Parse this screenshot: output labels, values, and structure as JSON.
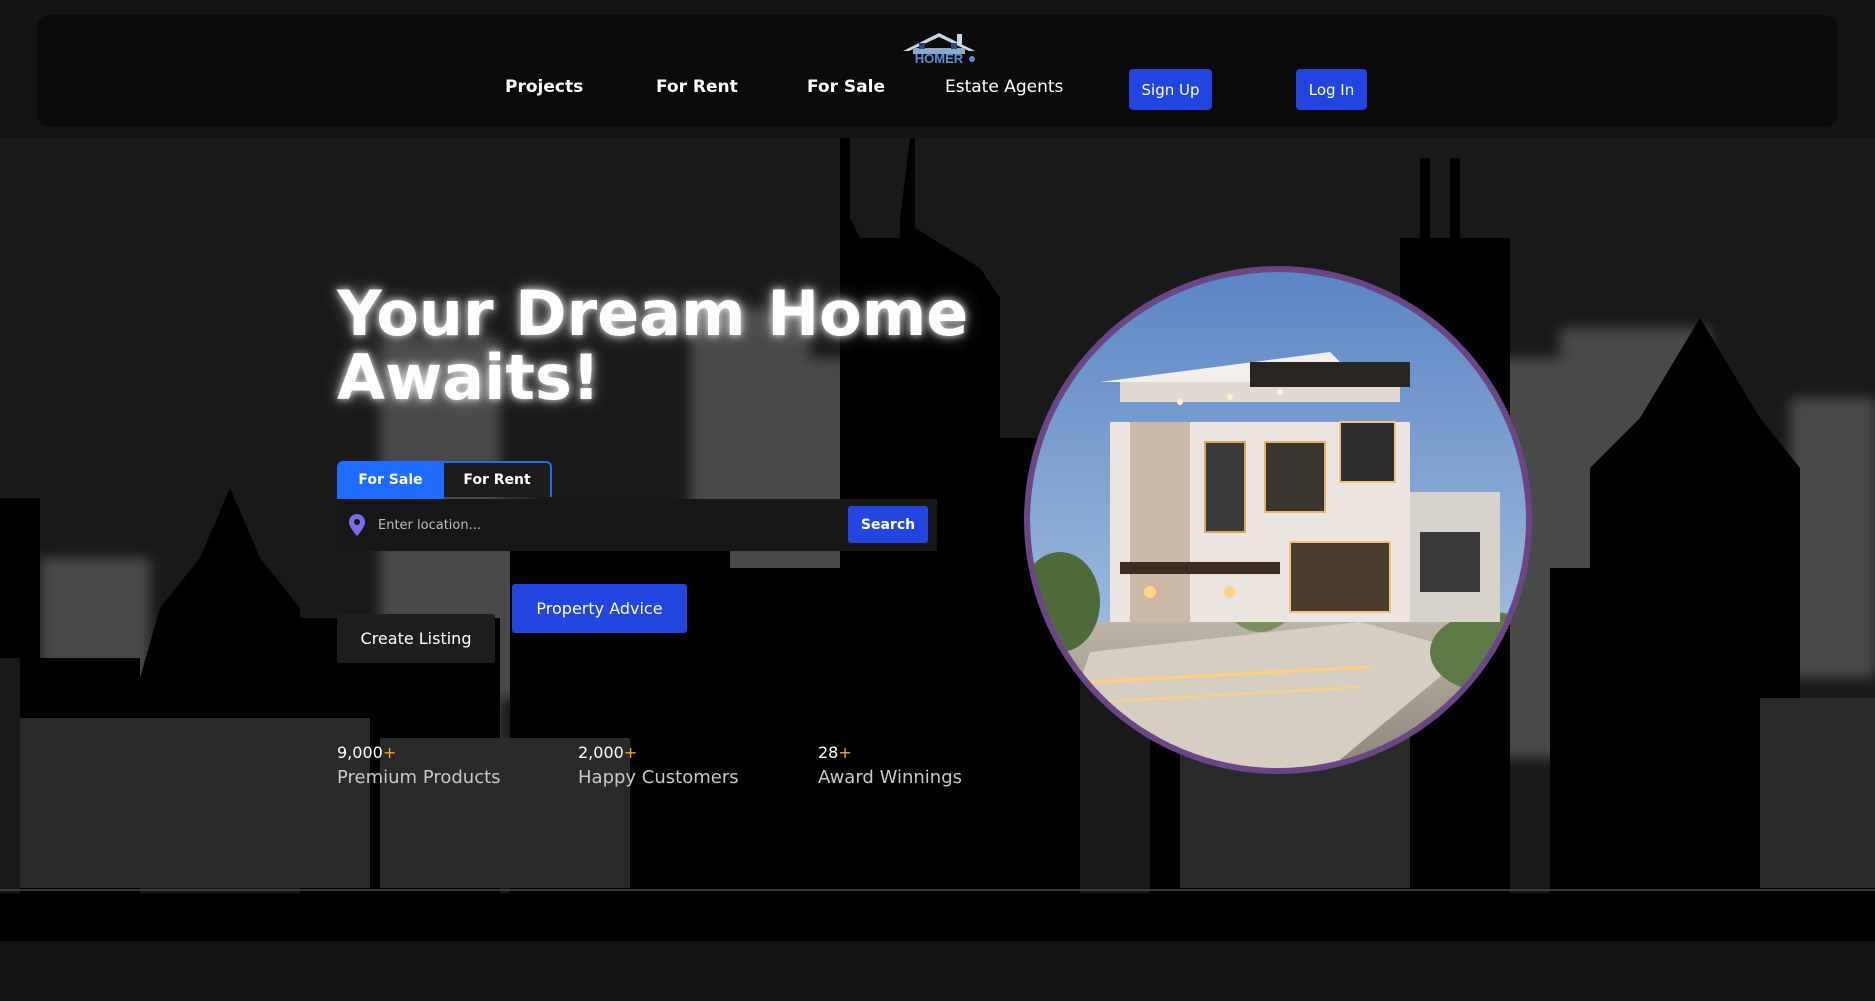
{
  "nav": {
    "logo_text": "HOMER",
    "links": [
      {
        "label": "Projects"
      },
      {
        "label": "For Rent"
      },
      {
        "label": "For Sale"
      },
      {
        "label": "Estate Agents"
      }
    ],
    "signup_label": "Sign Up",
    "login_label": "Log In"
  },
  "hero": {
    "headline_line1": "Your Dream Home",
    "headline_line2": "Awaits!",
    "tabs": {
      "sale": "For Sale",
      "rent": "For Rent"
    },
    "search": {
      "placeholder": "Enter location...",
      "value": "",
      "button_label": "Search"
    },
    "property_advice_label": "Property Advice",
    "create_listing_label": "Create Listing",
    "stats": [
      {
        "number": "9,000",
        "suffix": "+",
        "label": "Premium Products"
      },
      {
        "number": "2,000",
        "suffix": "+",
        "label": "Happy Customers"
      },
      {
        "number": "28",
        "suffix": "+",
        "label": "Award Winnings"
      }
    ]
  },
  "colors": {
    "accent_blue": "#2245e0",
    "tab_blue": "#1f6bff",
    "plus_orange": "#f5a623",
    "circle_border": "#6b4585",
    "pin_purple": "#7a6cf0"
  },
  "icons": {
    "location": "map-pin-icon",
    "logo": "house-logo-icon"
  }
}
